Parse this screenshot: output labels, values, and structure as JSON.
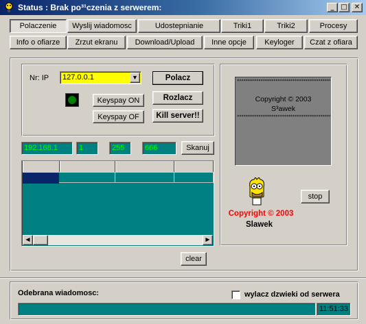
{
  "window": {
    "title": "Status : Brak po³¹czenia z serwerem:",
    "minimize": "_",
    "maximize": "□",
    "close": "✕"
  },
  "tabs_row1": [
    "Polaczenie",
    "Wyslij wiadomosc",
    "Udostepnianie",
    "Triki1",
    "Triki2",
    "Procesy"
  ],
  "tabs_row2": [
    "Info o ofiarze",
    "Zrzut ekranu",
    "Download/Upload",
    "Inne opcje",
    "Keyloger",
    "Czat z ofiara"
  ],
  "connection": {
    "ip_label": "Nr: IP",
    "ip_value": "127.0.0.1",
    "connect": "Polacz",
    "disconnect": "Rozlacz",
    "kill_server": "Kill server!!",
    "keyspay_on": "Keyspay ON",
    "keyspay_off": "Keyspay OF"
  },
  "scan": {
    "base_ip": "192.168.1",
    "from": "1",
    "to": "255",
    "port": "666",
    "button": "Skanuj"
  },
  "clear_button": "clear",
  "about": {
    "stars": "***************************************************",
    "screen_line1": "Copyright © 2003",
    "screen_line2": "S³awek",
    "copyright_red": "Copyright © 2003",
    "author": "Slawek",
    "stop_button": "stop"
  },
  "bottom": {
    "received_label": "Odebrana wiadomosc:",
    "mute_checkbox_label": "wylacz dzwieki od serwera",
    "time": "11:51:33",
    "message": ""
  },
  "colors": {
    "teal": "#008080",
    "green_text": "#00ff00",
    "yellow_field": "#ffff00",
    "red_text": "#ff0000",
    "led": "#008000"
  }
}
